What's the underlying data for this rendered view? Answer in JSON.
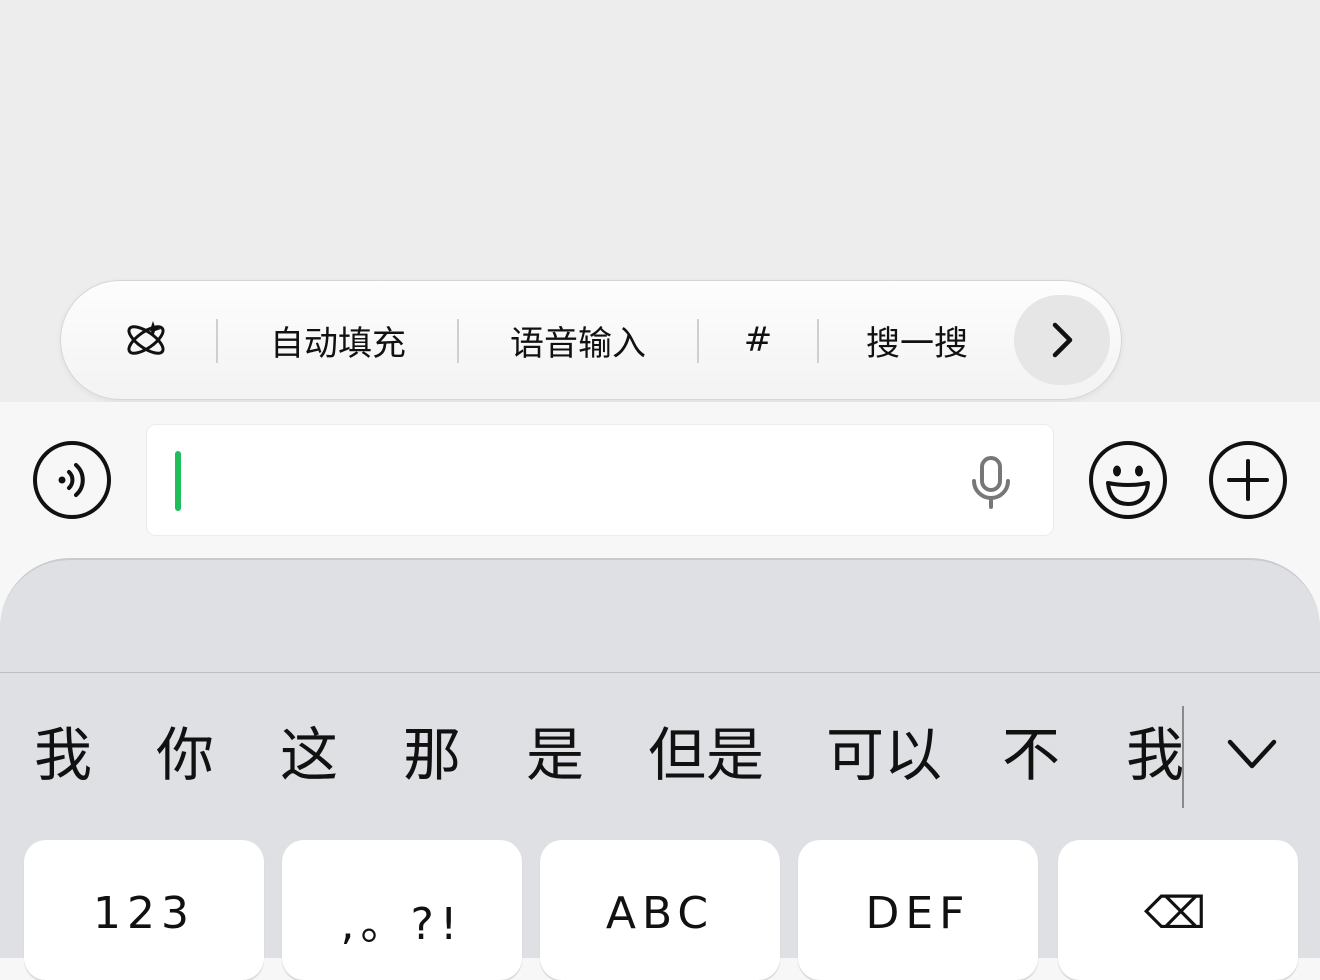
{
  "quick_bar": {
    "items": [
      {
        "name": "ai-assist",
        "icon": "atom-sparkle-icon"
      },
      {
        "name": "autofill",
        "label": "自动填充"
      },
      {
        "name": "voice-input",
        "label": "语音输入"
      },
      {
        "name": "hashtag",
        "label": "#"
      },
      {
        "name": "search",
        "label": "搜一搜"
      }
    ],
    "more_icon": "chevron-right-icon"
  },
  "input_bar": {
    "voice_toggle_icon": "voice-wave-icon",
    "message_value": "",
    "mic_icon": "microphone-icon",
    "emoji_icon": "smiley-icon",
    "add_icon": "plus-circle-icon",
    "caret_color": "#1fbe5a"
  },
  "keyboard": {
    "candidates": [
      "我",
      "你",
      "这",
      "那",
      "是",
      "但是",
      "可以",
      "不",
      "我"
    ],
    "expand_icon": "chevron-down-icon",
    "keys": [
      "123",
      ",。?!",
      "ABC",
      "DEF",
      "⌫"
    ]
  }
}
